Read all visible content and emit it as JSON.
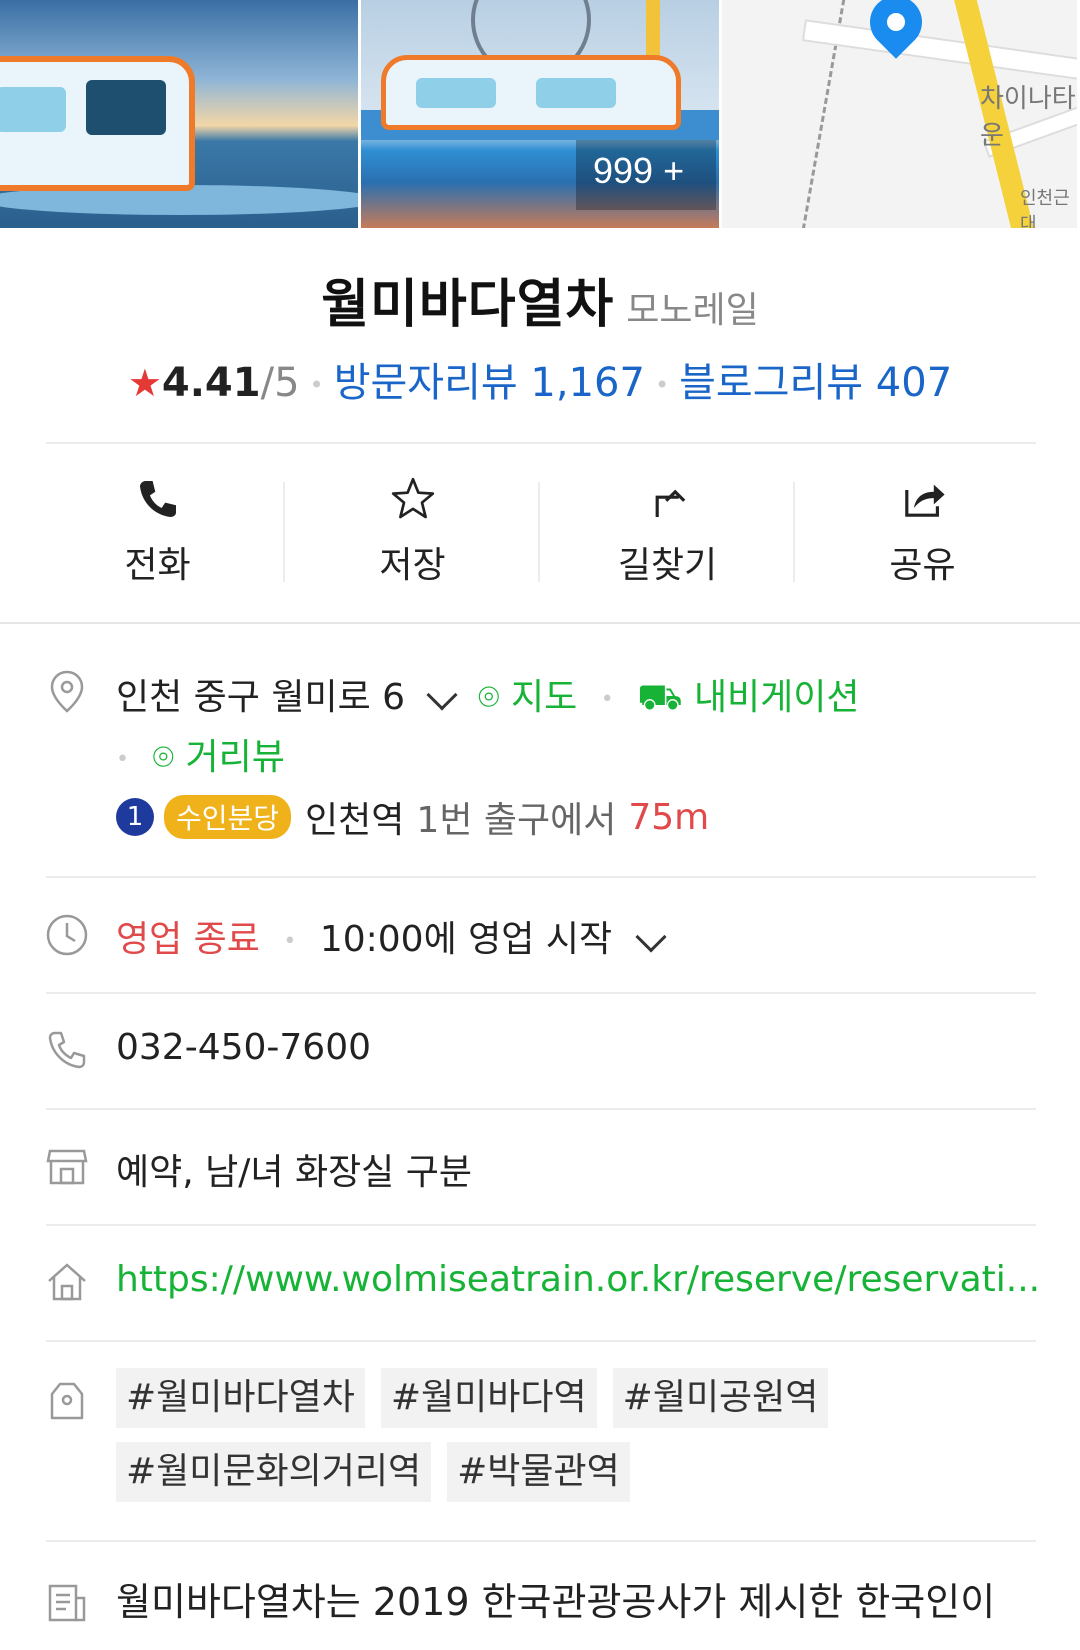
{
  "photos": {
    "count_label": "999 +",
    "map_labels": [
      "차이나타운",
      "인천근대"
    ]
  },
  "place": {
    "name": "월미바다열차",
    "category": "모노레일",
    "rating": "4.41",
    "rating_outof": "/5",
    "visitor_reviews": "방문자리뷰 1,167",
    "blog_reviews": "블로그리뷰 407"
  },
  "actions": [
    {
      "label": "전화",
      "icon": "phone-icon"
    },
    {
      "label": "저장",
      "icon": "star-icon"
    },
    {
      "label": "길찾기",
      "icon": "directions-icon"
    },
    {
      "label": "공유",
      "icon": "share-icon"
    }
  ],
  "address": {
    "text": "인천 중구 월미로 6",
    "map_link": "지도",
    "navigation_link": "내비게이션",
    "street_view_link": "거리뷰"
  },
  "transit": {
    "line_number": "1",
    "line_name": "수인분당",
    "station": "인천역",
    "exit": "1번 출구에서",
    "distance": "75m"
  },
  "hours": {
    "status": "영업 종료",
    "next_open": "10:00에 영업 시작"
  },
  "phone": "032-450-7600",
  "amenities": "예약, 남/녀 화장실 구분",
  "website": "https://www.wolmiseatrain.or.kr/reserve/reservati...",
  "tags": [
    "#월미바다열차",
    "#월미바다역",
    "#월미공원역",
    "#월미문화의거리역",
    "#박물관역"
  ],
  "description": "월미바다열차는 2019 한국관광공사가 제시한 한국인이",
  "colors": {
    "accent_blue": "#1a66c8",
    "accent_green": "#16b336",
    "closed_red": "#e04a4a",
    "star_red": "#e53935"
  }
}
